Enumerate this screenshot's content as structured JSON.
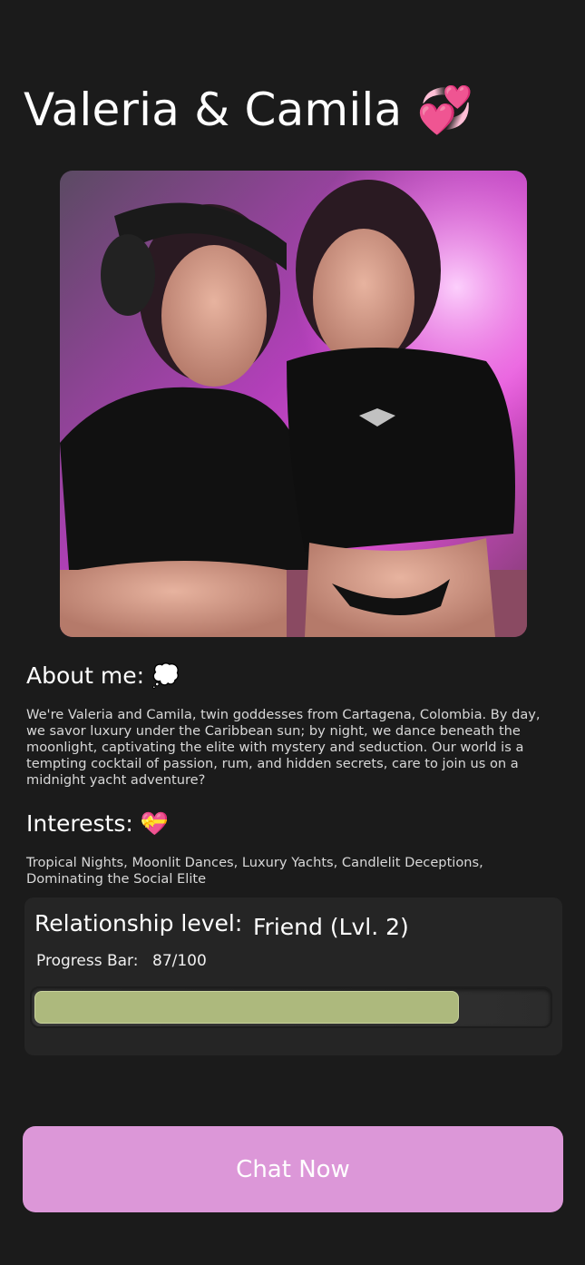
{
  "profile": {
    "name": "Valeria & Camila",
    "name_emoji": "💞"
  },
  "about": {
    "title": "About me:",
    "emoji": "💭",
    "text": "We're Valeria and Camila, twin goddesses from Cartagena, Colombia. By day, we savor luxury under the Caribbean sun; by night, we dance beneath the moonlight, captivating the elite with mystery and seduction. Our world is a tempting cocktail of passion, rum, and hidden secrets, care to join us on a midnight yacht adventure?"
  },
  "interests": {
    "title": "Interests:",
    "emoji": "💝",
    "text": "Tropical Nights, Moonlit Dances, Luxury Yachts, Candlelit Deceptions, Dominating the Social Elite"
  },
  "relationship": {
    "label": "Relationship level:",
    "value": "Friend (Lvl. 2)",
    "progress_label": "Progress Bar:",
    "progress_text": "87/100",
    "progress_fraction": 0.87
  },
  "actions": {
    "chat_label": "Chat Now"
  },
  "colors": {
    "background": "#1b1b1b",
    "card": "#252525",
    "progress_fill": "#adb97d",
    "chat_button": "#dc97d8"
  }
}
